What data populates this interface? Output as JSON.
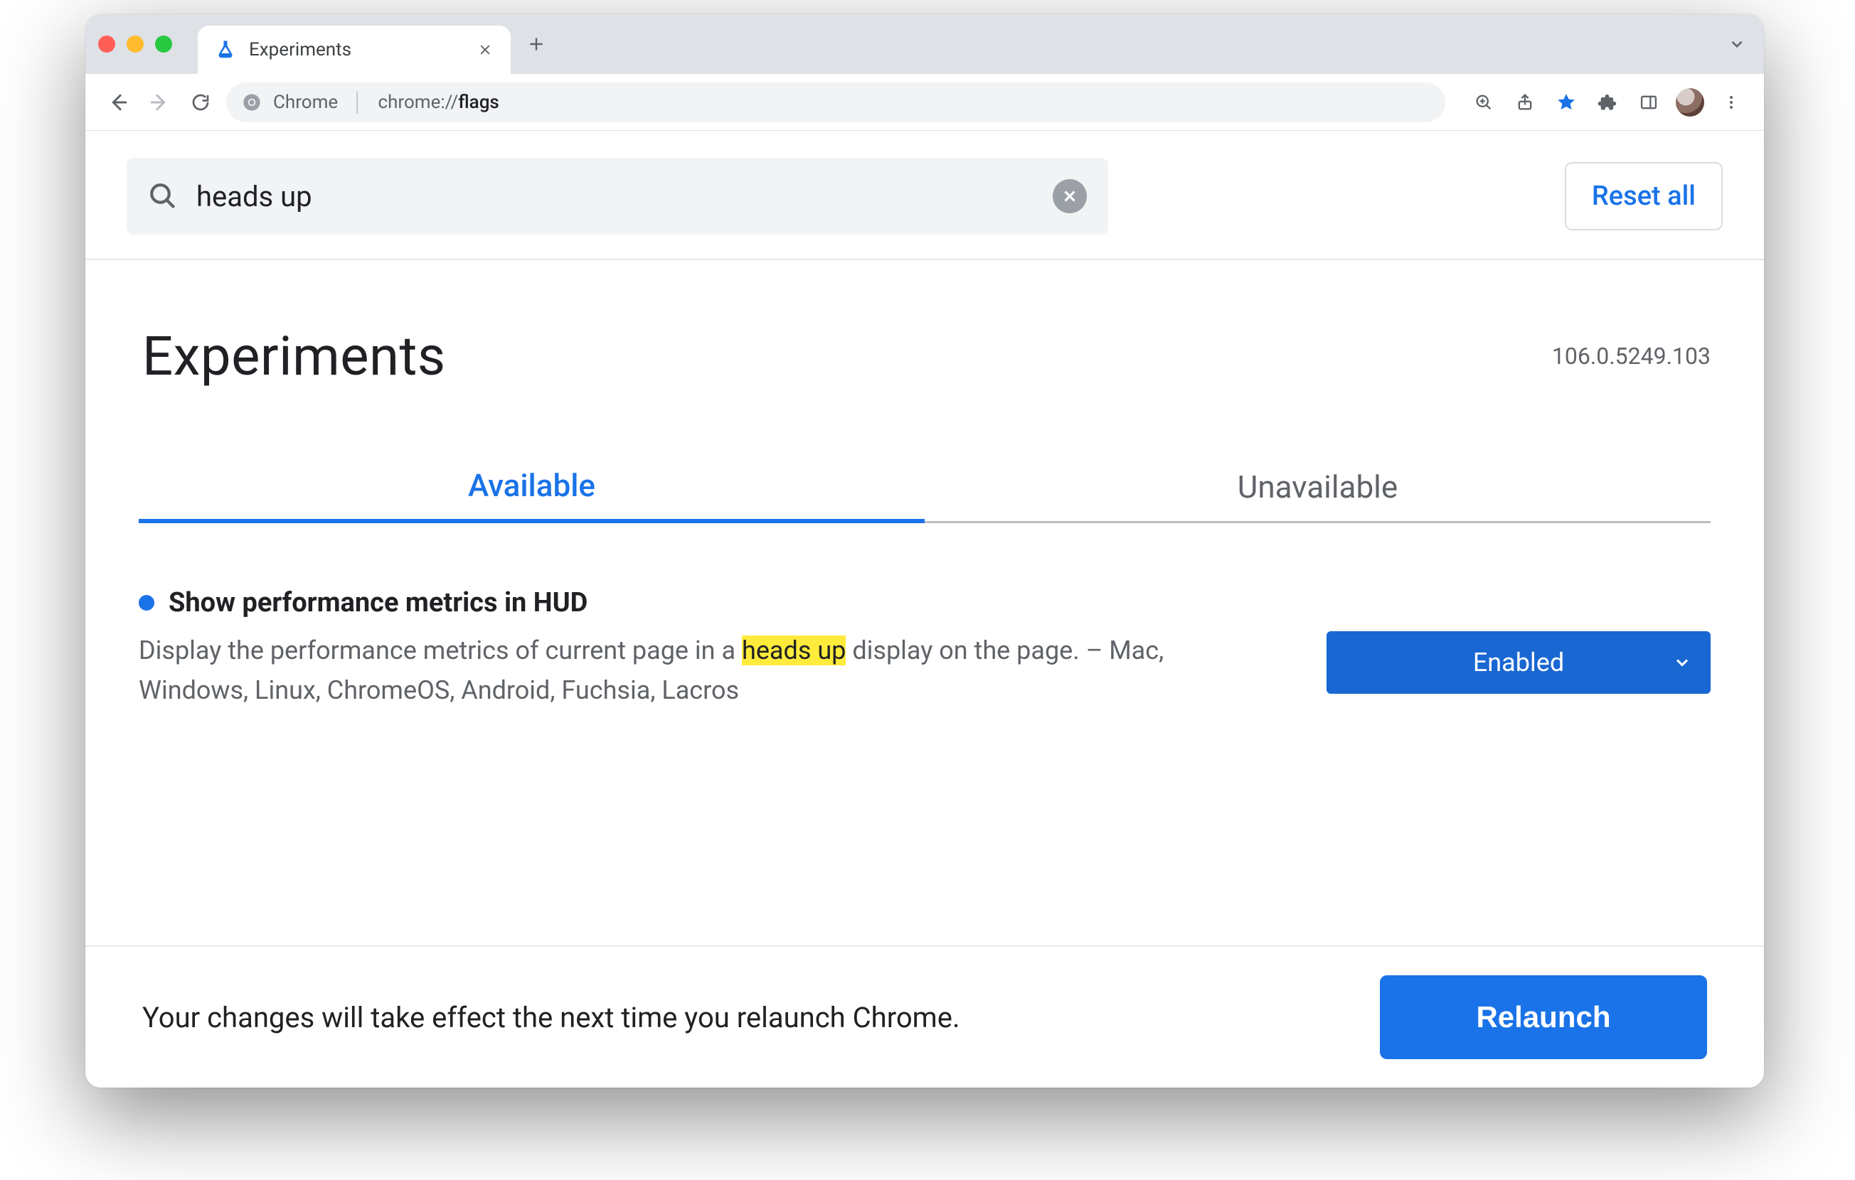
{
  "window": {
    "tab_title": "Experiments",
    "url_host": "Chrome",
    "url_prefix": "chrome://",
    "url_path": "flags"
  },
  "search": {
    "value": "heads up",
    "reset_label": "Reset all"
  },
  "header": {
    "title": "Experiments",
    "version": "106.0.5249.103"
  },
  "tabs": {
    "available": "Available",
    "unavailable": "Unavailable",
    "active": "available"
  },
  "flag": {
    "title": "Show performance metrics in HUD",
    "desc_before": "Display the performance metrics of current page in a ",
    "desc_highlight": "heads up",
    "desc_after": " display on the page. – Mac, Windows, Linux, ChromeOS, Android, Fuchsia, Lacros",
    "select_value": "Enabled"
  },
  "footer": {
    "message": "Your changes will take effect the next time you relaunch Chrome.",
    "button": "Relaunch"
  }
}
